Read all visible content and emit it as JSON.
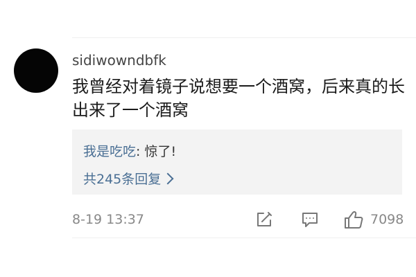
{
  "comment": {
    "username": "sidiwowndbfk",
    "text": "我曾经对着镜子说想要一个酒窝，后来真的长出来了一个酒窝",
    "timestamp": "8-19 13:37",
    "likes": "7098"
  },
  "reply_preview": {
    "user": "我是吃吃",
    "separator": ":",
    "text": " 惊了!",
    "more_label": "共245条回复"
  },
  "icons": {
    "edit": "edit-icon",
    "comment": "comment-icon",
    "like": "thumbs-up-icon",
    "more": "chevron-right-icon"
  },
  "colors": {
    "link": "#4a6f94",
    "text": "#1b1b1b",
    "muted": "#888888",
    "reply_bg": "#f3f3f3"
  }
}
